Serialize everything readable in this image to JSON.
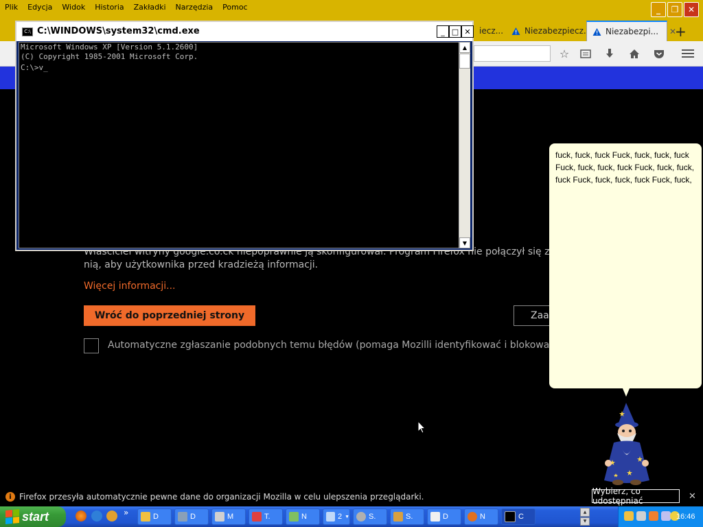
{
  "menubar": {
    "items": [
      "Plik",
      "Edycja",
      "Widok",
      "Historia",
      "Zakładki",
      "Narzędzia",
      "Pomoc"
    ]
  },
  "tabs": [
    {
      "label": "iecz...",
      "warning": false
    },
    {
      "label": "Niezabezpiecz...",
      "warning": true
    },
    {
      "label": "Niezabezpi...",
      "warning": true,
      "active": true
    }
  ],
  "new_tab": "+",
  "error_page": {
    "paragraph": "Właściciel witryny google.co.ck niepoprawnie ją skonfigurował. Program Firefox nie połączył się z nią, aby użytkownika przed kradzieżą informacji.",
    "more_info_link": "Więcej informacji...",
    "back_button": "Wróć do poprzedniej strony",
    "advanced_button": "Zaaw",
    "report_checkbox_label": "Automatyczne zgłaszanie podobnych temu błędów (pomaga Mozilli identyfikować i blokować niebez"
  },
  "cmd": {
    "title": "C:\\WINDOWS\\system32\\cmd.exe",
    "icon_label": "C:\\",
    "lines": [
      "Microsoft Windows XP [Version 5.1.2600]",
      "(C) Copyright 1985-2001 Microsoft Corp.",
      "",
      "C:\\>v_"
    ],
    "minimize": "_",
    "maximize": "□",
    "close": "✕"
  },
  "assistant": {
    "bubble_text": "fuck, fuck, fuck Fuck, fuck, fuck, fuck Fuck, fuck, fuck, fuck Fuck, fuck, fuck, fuck Fuck, fuck, fuck, fuck Fuck, fuck,"
  },
  "notification": {
    "text": "Firefox przesyła automatycznie pewne dane do organizacji Mozilla w celu ulepszenia przeglądarki.",
    "button": "Wybierz, co udostępniać",
    "close": "✕",
    "icon": "i"
  },
  "taskbar": {
    "start_label": "start",
    "chevron": "»",
    "buttons": [
      {
        "label": "D"
      },
      {
        "label": "D"
      },
      {
        "label": "M"
      },
      {
        "label": "T."
      },
      {
        "label": "N"
      },
      {
        "label": "2"
      },
      {
        "label": "S."
      },
      {
        "label": "S."
      },
      {
        "label": "D"
      },
      {
        "label": "N"
      },
      {
        "label": "C"
      }
    ],
    "clock": "16:46"
  },
  "colors": {
    "firefox_chrome": "#d8b400",
    "error_accent": "#f06a2a",
    "blue_bar": "#2233dd",
    "bubble_bg": "#ffffe1",
    "taskbar_blue": "#245edb",
    "start_green": "#379a37"
  }
}
